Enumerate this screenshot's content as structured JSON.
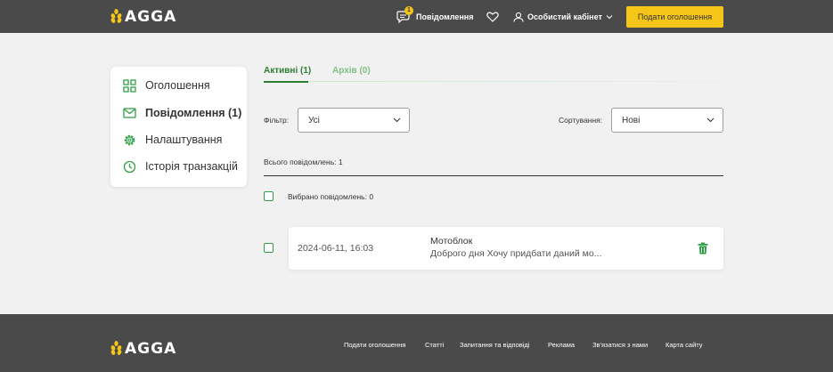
{
  "header": {
    "logo_text": "AGGA",
    "messages_label": "Повідомлення",
    "messages_badge": "1",
    "cabinet_label": "Особистий кабінет",
    "post_ad_label": "Подати оголошення",
    "brand_color": "#f5c518"
  },
  "sidebar": {
    "items": [
      {
        "label": "Оголошення",
        "icon": "grid-icon"
      },
      {
        "label": "Повідомлення (1)",
        "icon": "envelope-icon",
        "active": true
      },
      {
        "label": "Налаштування",
        "icon": "gear-icon"
      },
      {
        "label": "Історія транзакцій",
        "icon": "clock-icon"
      }
    ]
  },
  "tabs": {
    "active_label": "Активні (1)",
    "archive_label": "Архів (0)"
  },
  "filters": {
    "filter_label": "Фільтр:",
    "filter_value": "Усі",
    "sort_label": "Сортування:",
    "sort_value": "Нові"
  },
  "summary": {
    "total_text": "Всього повідомлень: 1",
    "selected_text": "Вибрано повідомлень: 0"
  },
  "messages": [
    {
      "date": "2024-06-11, 16:03",
      "title": "Мотоблок",
      "preview": "Доброго дня Хочу придбати даний мо..."
    }
  ],
  "footer": {
    "logo_text": "AGGA",
    "links": [
      "Подати оголошення",
      "Статті",
      "Запитання та відповіді",
      "Реклама",
      "Зв'язатися з нами",
      "Карта сайту"
    ]
  }
}
